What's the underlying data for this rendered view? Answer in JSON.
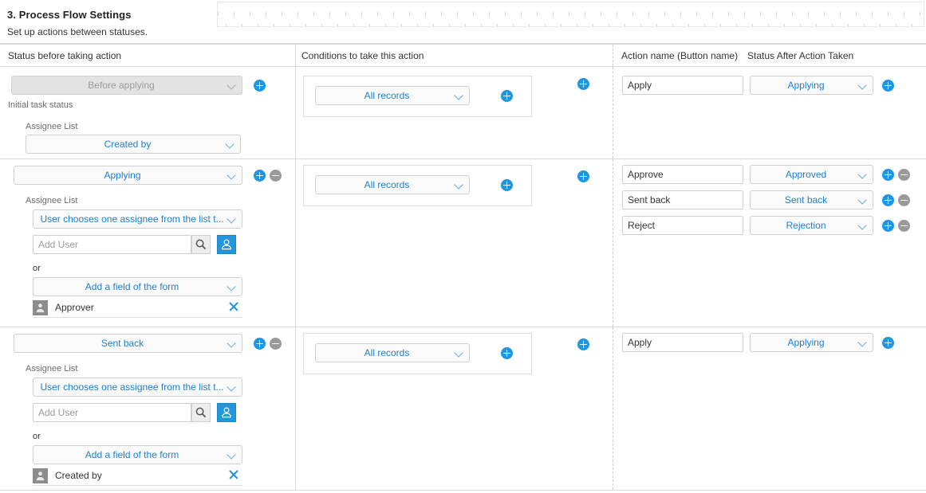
{
  "header": {
    "title": "3. Process Flow Settings",
    "subtitle": "Set up actions between statuses."
  },
  "columns": {
    "status_before": "Status before taking action",
    "conditions": "Conditions to take this action",
    "action_name": "Action name (Button name)",
    "status_after": "Status After Action Taken"
  },
  "labels": {
    "assignee_list": "Assignee List",
    "initial_task_status": "Initial task status",
    "or": "or",
    "add_user_placeholder": "Add User",
    "add_field": "Add a field of the form",
    "search_icon": "search-icon",
    "user_picker_icon": "user-picker-icon",
    "avatar_icon": "person-avatar-icon",
    "remove_icon": "close-icon",
    "add_icon": "plus-icon",
    "delete_icon": "minus-icon",
    "chevron_icon": "chevron-down-icon"
  },
  "colors": {
    "accent": "#2196dd",
    "link": "#1f7fd0",
    "muted": "#9a9a9a",
    "border": "#d9d9d9"
  },
  "rows": [
    {
      "status": "Before applying",
      "status_disabled": true,
      "note": "Initial task status",
      "assignee_mode": "Created by",
      "has_user_picker": false,
      "has_remove": false,
      "conditions": "All records",
      "actions": [
        {
          "name": "Apply",
          "after": "Applying",
          "has_remove": false
        }
      ]
    },
    {
      "status": "Applying",
      "status_disabled": false,
      "note": "",
      "assignee_mode": "User chooses one assignee from the list t...",
      "has_user_picker": true,
      "has_remove": true,
      "field_select": "Add a field of the form",
      "assignee_chip": "Approver",
      "conditions": "All records",
      "actions": [
        {
          "name": "Approve",
          "after": "Approved",
          "has_remove": true
        },
        {
          "name": "Sent back",
          "after": "Sent back",
          "has_remove": true
        },
        {
          "name": "Reject",
          "after": "Rejection",
          "has_remove": true
        }
      ]
    },
    {
      "status": "Sent back",
      "status_disabled": false,
      "note": "",
      "assignee_mode": "User chooses one assignee from the list t...",
      "has_user_picker": true,
      "has_remove": true,
      "field_select": "Add a field of the form",
      "assignee_chip": "Created by",
      "conditions": "All records",
      "actions": [
        {
          "name": "Apply",
          "after": "Applying",
          "has_remove": false
        }
      ]
    }
  ]
}
